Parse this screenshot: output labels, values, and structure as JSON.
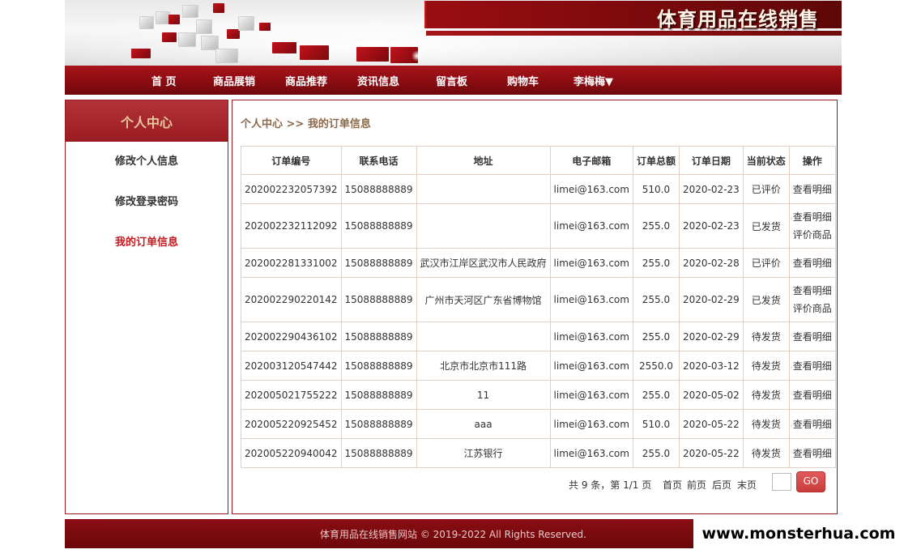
{
  "header": {
    "site_title": "体育用品在线销售"
  },
  "nav": {
    "items": [
      "首 页",
      "商品展销",
      "商品推荐",
      "资讯信息",
      "留言板",
      "购物车"
    ],
    "user": "李梅梅▼"
  },
  "sidebar": {
    "title": "个人中心",
    "links": [
      "修改个人信息",
      "修改登录密码",
      "我的订单信息"
    ]
  },
  "main": {
    "breadcrumb": "个人中心 >> 我的订单信息",
    "table": {
      "headers": [
        "订单编号",
        "联系电话",
        "地址",
        "电子邮箱",
        "订单总额",
        "订单日期",
        "当前状态",
        "操作"
      ],
      "rows": [
        {
          "id": "202002232057392",
          "phone": "15088888889",
          "address": "",
          "email": "limei@163.com",
          "total": "510.0",
          "date": "2020-02-23",
          "status": "已评价",
          "actions": [
            "查看明细"
          ]
        },
        {
          "id": "202002232112092",
          "phone": "15088888889",
          "address": "",
          "email": "limei@163.com",
          "total": "255.0",
          "date": "2020-02-23",
          "status": "已发货",
          "actions": [
            "查看明细",
            "评价商品"
          ]
        },
        {
          "id": "202002281331002",
          "phone": "15088888889",
          "address": "武汉市江岸区武汉市人民政府",
          "email": "limei@163.com",
          "total": "255.0",
          "date": "2020-02-28",
          "status": "已评价",
          "actions": [
            "查看明细"
          ]
        },
        {
          "id": "202002290220142",
          "phone": "15088888889",
          "address": "广州市天河区广东省博物馆",
          "email": "limei@163.com",
          "total": "255.0",
          "date": "2020-02-29",
          "status": "已发货",
          "actions": [
            "查看明细",
            "评价商品"
          ]
        },
        {
          "id": "202002290436102",
          "phone": "15088888889",
          "address": "",
          "email": "limei@163.com",
          "total": "255.0",
          "date": "2020-02-29",
          "status": "待发货",
          "actions": [
            "查看明细"
          ]
        },
        {
          "id": "202003120547442",
          "phone": "15088888889",
          "address": "北京市北京市111路",
          "email": "limei@163.com",
          "total": "2550.0",
          "date": "2020-03-12",
          "status": "待发货",
          "actions": [
            "查看明细"
          ]
        },
        {
          "id": "202005021755222",
          "phone": "15088888889",
          "address": "11",
          "email": "limei@163.com",
          "total": "255.0",
          "date": "2020-05-02",
          "status": "待发货",
          "actions": [
            "查看明细"
          ]
        },
        {
          "id": "202005220925452",
          "phone": "15088888889",
          "address": "aaa",
          "email": "limei@163.com",
          "total": "510.0",
          "date": "2020-05-22",
          "status": "待发货",
          "actions": [
            "查看明细"
          ]
        },
        {
          "id": "202005220940042",
          "phone": "15088888889",
          "address": "江苏银行",
          "email": "limei@163.com",
          "total": "255.0",
          "date": "2020-05-22",
          "status": "待发货",
          "actions": [
            "查看明细"
          ]
        }
      ]
    },
    "pager": {
      "summary": "共 9 条，第 1/1 页",
      "first": "首页",
      "prev": "前页",
      "next": "后页",
      "last": "末页",
      "page_input": "",
      "go": "GO"
    }
  },
  "footer": {
    "text": "体育用品在线销售网站 © 2019-2022 All Rights Reserved."
  },
  "watermark": "www.monsterhua.com",
  "colors": {
    "brand_red": "#8a0c12",
    "accent": "#c21a20"
  }
}
